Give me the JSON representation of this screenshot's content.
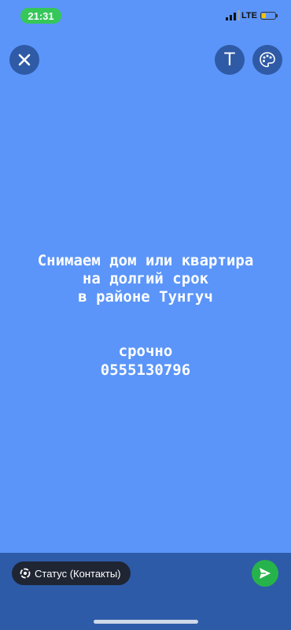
{
  "status_bar": {
    "time": "21:31",
    "network": "LTE",
    "battery_level": 0.3,
    "time_pill_color": "#35c759"
  },
  "toolbar": {
    "close_icon": "close-icon",
    "text_tool_label": "T",
    "palette_icon": "palette-icon"
  },
  "message": {
    "lines": [
      "Снимаем дом или квартира",
      "на долгий срок",
      "в районе Тунгуч"
    ],
    "urgent": "срочно",
    "phone": "0555130796"
  },
  "footer": {
    "status_chip_label": "Статус (Контакты)",
    "send_icon": "send-icon"
  },
  "colors": {
    "background": "#5b95f9",
    "bottom_bar": "#2d5ba8",
    "send_button": "#27b34b"
  }
}
